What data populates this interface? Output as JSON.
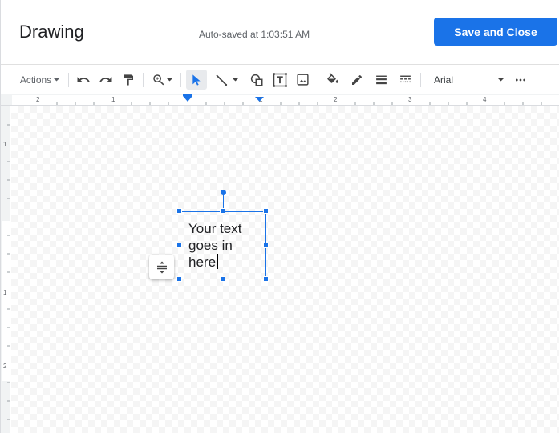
{
  "header": {
    "title": "Drawing",
    "autosave": "Auto-saved at 1:03:51 AM",
    "save_close_label": "Save and Close"
  },
  "toolbar": {
    "actions_label": "Actions",
    "font_name": "Arial",
    "tools": [
      "undo-icon",
      "redo-icon",
      "paint-format-icon",
      "zoom-icon",
      "select-icon",
      "line-icon",
      "shape-icon",
      "text-box-icon",
      "image-icon",
      "fill-color-icon",
      "border-color-icon",
      "border-weight-icon",
      "border-dash-icon",
      "more-icon"
    ]
  },
  "rulers": {
    "top_labels": [
      "2",
      "1",
      "1",
      "2",
      "3",
      "4"
    ],
    "left_labels": [
      "1",
      "1",
      "2"
    ]
  },
  "textbox": {
    "text": "Your text goes in here"
  },
  "colors": {
    "accent": "#1a73e8",
    "text": "#202124",
    "secondary_text": "#5f6368"
  }
}
